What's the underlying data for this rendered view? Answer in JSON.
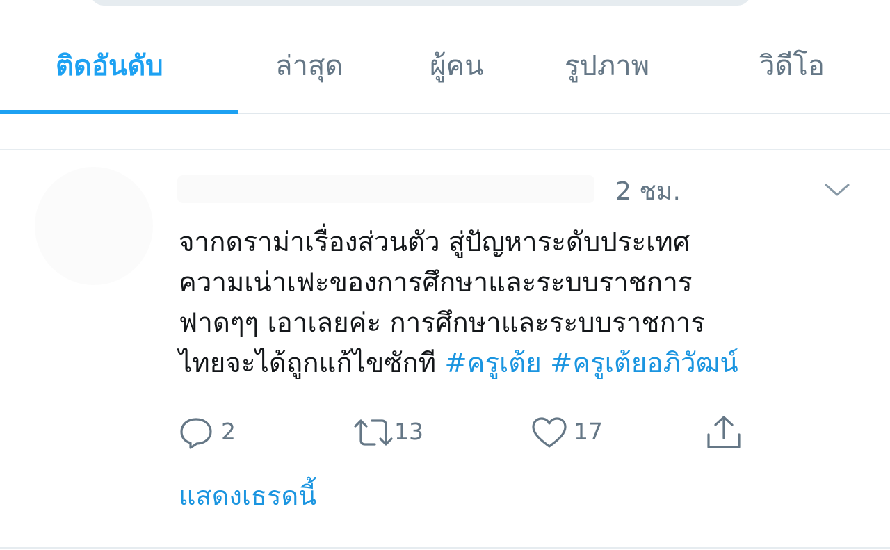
{
  "tabs": [
    {
      "label": "ติดอันดับ",
      "active": true
    },
    {
      "label": "ล่าสุด",
      "active": false
    },
    {
      "label": "ผู้คน",
      "active": false
    },
    {
      "label": "รูปภาพ",
      "active": false
    },
    {
      "label": "วิดีโอ",
      "active": false
    }
  ],
  "tweet": {
    "timestamp": "2 ชม.",
    "lines": [
      "จากดราม่าเรื่องส่วนตัว สู่ปัญหาระดับประเทศ",
      "ความเน่าเฟะของการศึกษาและระบบราชการ",
      "ฟาดๆๆ เอาเลยค่ะ การศึกษาและระบบราชการ",
      "ไทยจะได้ถูกแก้ไขซักที "
    ],
    "hashtags": [
      "#ครูเต้ย",
      "#ครูเต้ยอภิวัฒน์"
    ],
    "actions": {
      "reply": {
        "icon": "reply-icon",
        "count": "2"
      },
      "retweet": {
        "icon": "retweet-icon",
        "count": "13"
      },
      "like": {
        "icon": "heart-icon",
        "count": "17"
      },
      "share": {
        "icon": "share-icon"
      }
    },
    "show_thread": "แสดงเธรดนี้"
  },
  "colors": {
    "accent": "#1da1f2",
    "link": "#1b95e0",
    "muted": "#657786",
    "text": "#14171a",
    "divider": "#e6ecf0"
  }
}
